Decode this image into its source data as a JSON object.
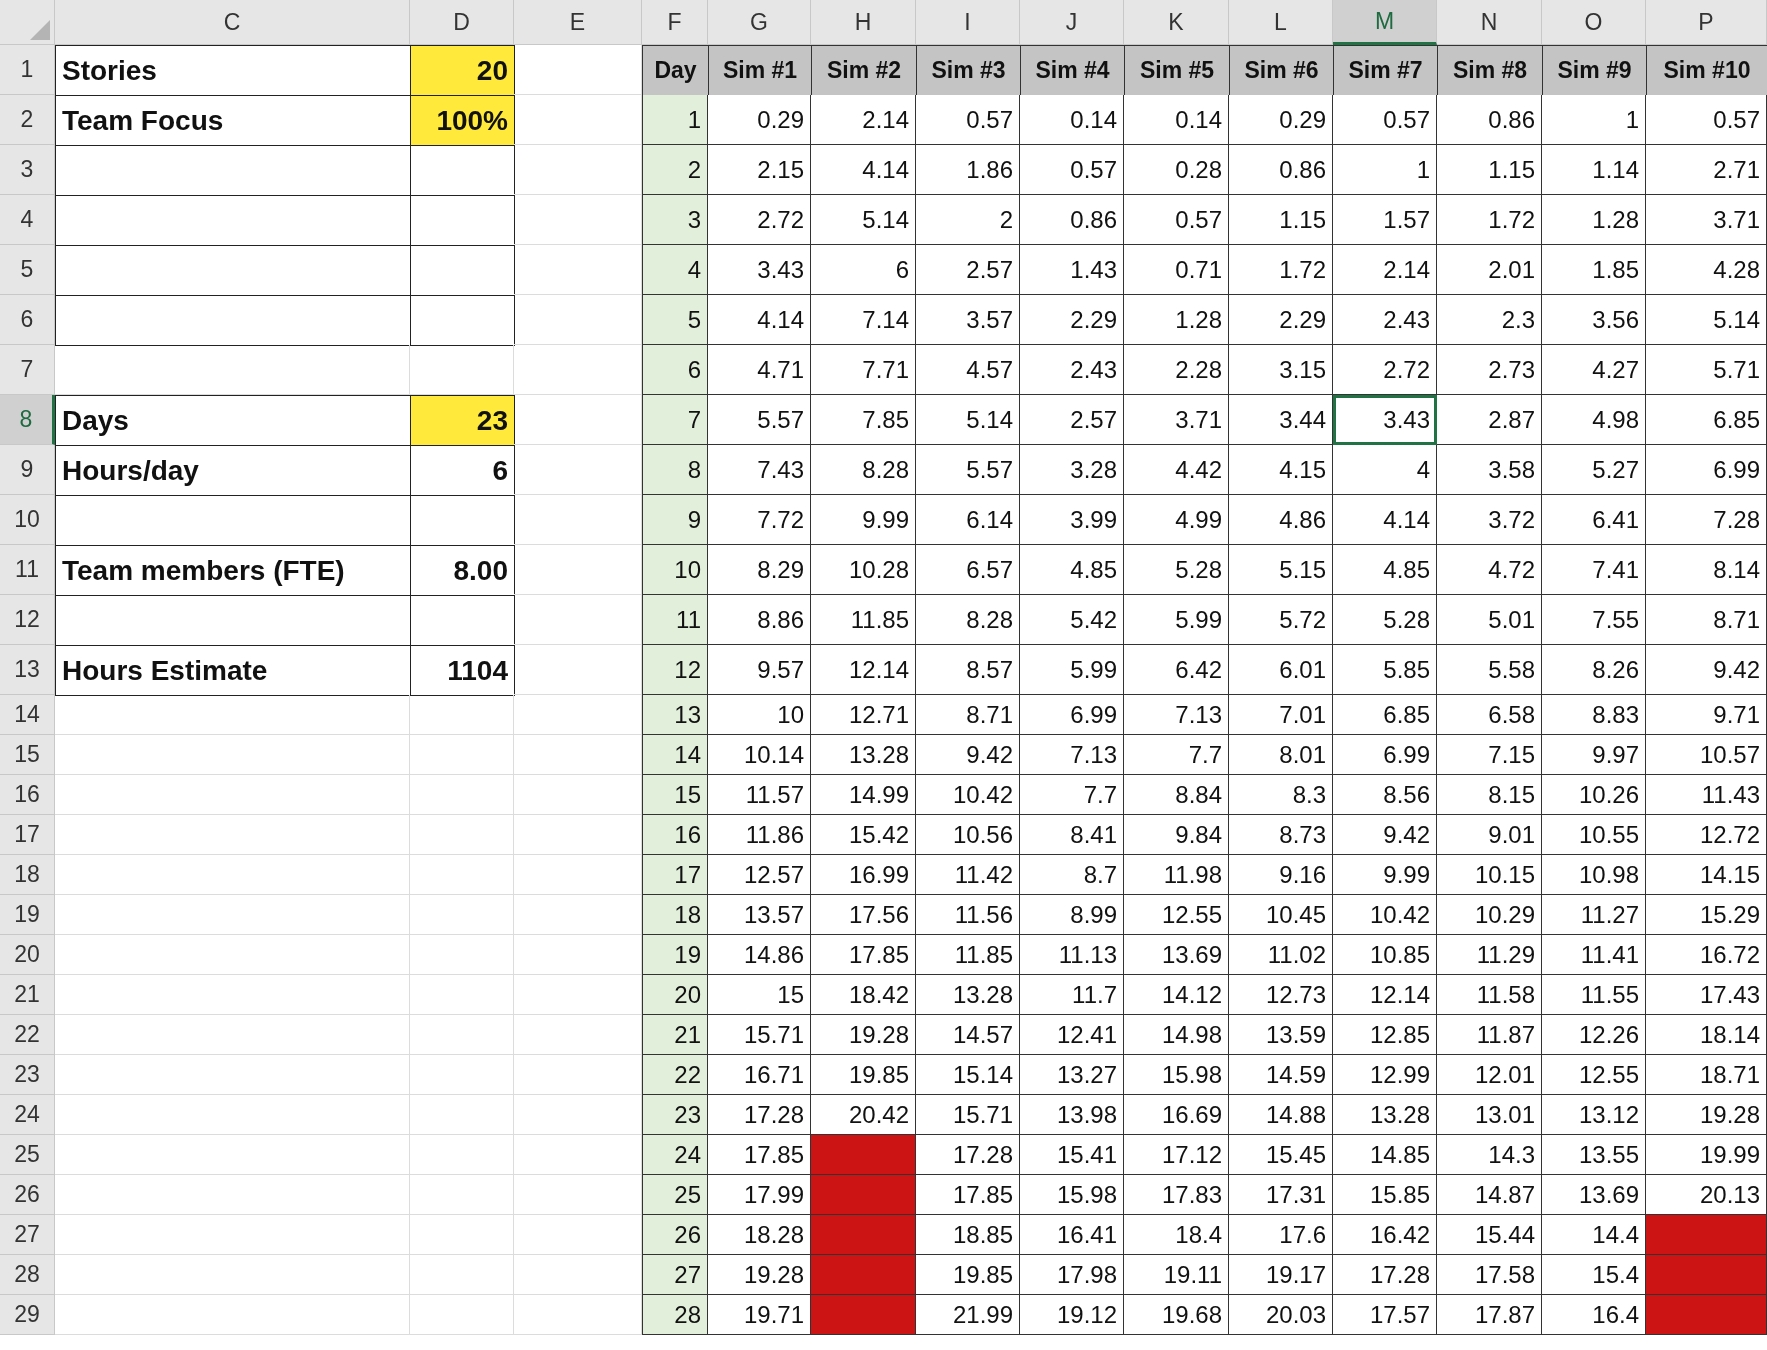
{
  "columns": [
    {
      "letter": "C",
      "selected": false
    },
    {
      "letter": "D",
      "selected": false
    },
    {
      "letter": "E",
      "selected": false
    },
    {
      "letter": "F",
      "selected": false
    },
    {
      "letter": "G",
      "selected": false
    },
    {
      "letter": "H",
      "selected": false
    },
    {
      "letter": "I",
      "selected": false
    },
    {
      "letter": "J",
      "selected": false
    },
    {
      "letter": "K",
      "selected": false
    },
    {
      "letter": "L",
      "selected": false
    },
    {
      "letter": "M",
      "selected": true
    },
    {
      "letter": "N",
      "selected": false
    },
    {
      "letter": "O",
      "selected": false
    },
    {
      "letter": "P",
      "selected": false
    }
  ],
  "row_headers": [
    {
      "label": "1",
      "selected": false
    },
    {
      "label": "2",
      "selected": false
    },
    {
      "label": "3",
      "selected": false
    },
    {
      "label": "4",
      "selected": false
    },
    {
      "label": "5",
      "selected": false
    },
    {
      "label": "6",
      "selected": false
    },
    {
      "label": "7",
      "selected": false
    },
    {
      "label": "8",
      "selected": true
    },
    {
      "label": "9",
      "selected": false
    },
    {
      "label": "10",
      "selected": false
    },
    {
      "label": "11",
      "selected": false
    },
    {
      "label": "12",
      "selected": false
    },
    {
      "label": "13",
      "selected": false
    },
    {
      "label": "14",
      "selected": false
    },
    {
      "label": "15",
      "selected": false
    },
    {
      "label": "16",
      "selected": false
    },
    {
      "label": "17",
      "selected": false
    },
    {
      "label": "18",
      "selected": false
    },
    {
      "label": "19",
      "selected": false
    },
    {
      "label": "20",
      "selected": false
    },
    {
      "label": "21",
      "selected": false
    },
    {
      "label": "22",
      "selected": false
    },
    {
      "label": "23",
      "selected": false
    },
    {
      "label": "24",
      "selected": false
    },
    {
      "label": "25",
      "selected": false
    },
    {
      "label": "26",
      "selected": false
    },
    {
      "label": "27",
      "selected": false
    },
    {
      "label": "28",
      "selected": false
    },
    {
      "label": "29",
      "selected": false
    }
  ],
  "inputs": [
    {
      "kind": "field",
      "label": "Stories",
      "value": "20",
      "highlight": true
    },
    {
      "kind": "field",
      "label": "Team Focus",
      "value": "100%",
      "highlight": true
    },
    {
      "kind": "box"
    },
    {
      "kind": "box"
    },
    {
      "kind": "box"
    },
    {
      "kind": "box"
    },
    {
      "kind": "none"
    },
    {
      "kind": "field",
      "label": "Days",
      "value": "23",
      "highlight": true
    },
    {
      "kind": "field",
      "label": "Hours/day",
      "value": "6",
      "highlight": false
    },
    {
      "kind": "box"
    },
    {
      "kind": "field",
      "label": "Team members (FTE)",
      "value": "8.00",
      "highlight": false
    },
    {
      "kind": "box"
    },
    {
      "kind": "field",
      "label": "Hours Estimate",
      "value": "1104",
      "highlight": false
    }
  ],
  "sim_table": {
    "header": [
      "Day",
      "Sim #1",
      "Sim #2",
      "Sim #3",
      "Sim #4",
      "Sim #5",
      "Sim #6",
      "Sim #7",
      "Sim #8",
      "Sim #9",
      "Sim #10"
    ],
    "rows": [
      {
        "day": "1",
        "values": [
          "0.29",
          "2.14",
          "0.57",
          "0.14",
          "0.14",
          "0.29",
          "0.57",
          "0.86",
          "1",
          "0.57"
        ]
      },
      {
        "day": "2",
        "values": [
          "2.15",
          "4.14",
          "1.86",
          "0.57",
          "0.28",
          "0.86",
          "1",
          "1.15",
          "1.14",
          "2.71"
        ]
      },
      {
        "day": "3",
        "values": [
          "2.72",
          "5.14",
          "2",
          "0.86",
          "0.57",
          "1.15",
          "1.57",
          "1.72",
          "1.28",
          "3.71"
        ]
      },
      {
        "day": "4",
        "values": [
          "3.43",
          "6",
          "2.57",
          "1.43",
          "0.71",
          "1.72",
          "2.14",
          "2.01",
          "1.85",
          "4.28"
        ]
      },
      {
        "day": "5",
        "values": [
          "4.14",
          "7.14",
          "3.57",
          "2.29",
          "1.28",
          "2.29",
          "2.43",
          "2.3",
          "3.56",
          "5.14"
        ]
      },
      {
        "day": "6",
        "values": [
          "4.71",
          "7.71",
          "4.57",
          "2.43",
          "2.28",
          "3.15",
          "2.72",
          "2.73",
          "4.27",
          "5.71"
        ]
      },
      {
        "day": "7",
        "values": [
          "5.57",
          "7.85",
          "5.14",
          "2.57",
          "3.71",
          "3.44",
          "3.43",
          "2.87",
          "4.98",
          "6.85"
        ]
      },
      {
        "day": "8",
        "values": [
          "7.43",
          "8.28",
          "5.57",
          "3.28",
          "4.42",
          "4.15",
          "4",
          "3.58",
          "5.27",
          "6.99"
        ]
      },
      {
        "day": "9",
        "values": [
          "7.72",
          "9.99",
          "6.14",
          "3.99",
          "4.99",
          "4.86",
          "4.14",
          "3.72",
          "6.41",
          "7.28"
        ]
      },
      {
        "day": "10",
        "values": [
          "8.29",
          "10.28",
          "6.57",
          "4.85",
          "5.28",
          "5.15",
          "4.85",
          "4.72",
          "7.41",
          "8.14"
        ]
      },
      {
        "day": "11",
        "values": [
          "8.86",
          "11.85",
          "8.28",
          "5.42",
          "5.99",
          "5.72",
          "5.28",
          "5.01",
          "7.55",
          "8.71"
        ]
      },
      {
        "day": "12",
        "values": [
          "9.57",
          "12.14",
          "8.57",
          "5.99",
          "6.42",
          "6.01",
          "5.85",
          "5.58",
          "8.26",
          "9.42"
        ]
      },
      {
        "day": "13",
        "values": [
          "10",
          "12.71",
          "8.71",
          "6.99",
          "7.13",
          "7.01",
          "6.85",
          "6.58",
          "8.83",
          "9.71"
        ]
      },
      {
        "day": "14",
        "values": [
          "10.14",
          "13.28",
          "9.42",
          "7.13",
          "7.7",
          "8.01",
          "6.99",
          "7.15",
          "9.97",
          "10.57"
        ]
      },
      {
        "day": "15",
        "values": [
          "11.57",
          "14.99",
          "10.42",
          "7.7",
          "8.84",
          "8.3",
          "8.56",
          "8.15",
          "10.26",
          "11.43"
        ]
      },
      {
        "day": "16",
        "values": [
          "11.86",
          "15.42",
          "10.56",
          "8.41",
          "9.84",
          "8.73",
          "9.42",
          "9.01",
          "10.55",
          "12.72"
        ]
      },
      {
        "day": "17",
        "values": [
          "12.57",
          "16.99",
          "11.42",
          "8.7",
          "11.98",
          "9.16",
          "9.99",
          "10.15",
          "10.98",
          "14.15"
        ]
      },
      {
        "day": "18",
        "values": [
          "13.57",
          "17.56",
          "11.56",
          "8.99",
          "12.55",
          "10.45",
          "10.42",
          "10.29",
          "11.27",
          "15.29"
        ]
      },
      {
        "day": "19",
        "values": [
          "14.86",
          "17.85",
          "11.85",
          "11.13",
          "13.69",
          "11.02",
          "10.85",
          "11.29",
          "11.41",
          "16.72"
        ]
      },
      {
        "day": "20",
        "values": [
          "15",
          "18.42",
          "13.28",
          "11.7",
          "14.12",
          "12.73",
          "12.14",
          "11.58",
          "11.55",
          "17.43"
        ]
      },
      {
        "day": "21",
        "values": [
          "15.71",
          "19.28",
          "14.57",
          "12.41",
          "14.98",
          "13.59",
          "12.85",
          "11.87",
          "12.26",
          "18.14"
        ]
      },
      {
        "day": "22",
        "values": [
          "16.71",
          "19.85",
          "15.14",
          "13.27",
          "15.98",
          "14.59",
          "12.99",
          "12.01",
          "12.55",
          "18.71"
        ]
      },
      {
        "day": "23",
        "values": [
          "17.28",
          "20.42",
          "15.71",
          "13.98",
          "16.69",
          "14.88",
          "13.28",
          "13.01",
          "13.12",
          "19.28"
        ]
      },
      {
        "day": "24",
        "values": [
          "17.85",
          {
            "kind": "overrun"
          },
          "17.28",
          "15.41",
          "17.12",
          "15.45",
          "14.85",
          "14.3",
          "13.55",
          "19.99"
        ]
      },
      {
        "day": "25",
        "values": [
          "17.99",
          {
            "kind": "overrun"
          },
          "17.85",
          "15.98",
          "17.83",
          "17.31",
          "15.85",
          "14.87",
          "13.69",
          "20.13"
        ]
      },
      {
        "day": "26",
        "values": [
          "18.28",
          {
            "kind": "overrun"
          },
          "18.85",
          "16.41",
          "18.4",
          "17.6",
          "16.42",
          "15.44",
          "14.4",
          {
            "kind": "overrun"
          }
        ]
      },
      {
        "day": "27",
        "values": [
          "19.28",
          {
            "kind": "overrun"
          },
          "19.85",
          "17.98",
          "19.11",
          "19.17",
          "17.28",
          "17.58",
          "15.4",
          {
            "kind": "overrun"
          }
        ]
      },
      {
        "day": "28",
        "values": [
          "19.71",
          {
            "kind": "overrun"
          },
          "21.99",
          "19.12",
          "19.68",
          "20.03",
          "17.57",
          "17.87",
          "16.4",
          {
            "kind": "overrun"
          }
        ]
      }
    ]
  }
}
